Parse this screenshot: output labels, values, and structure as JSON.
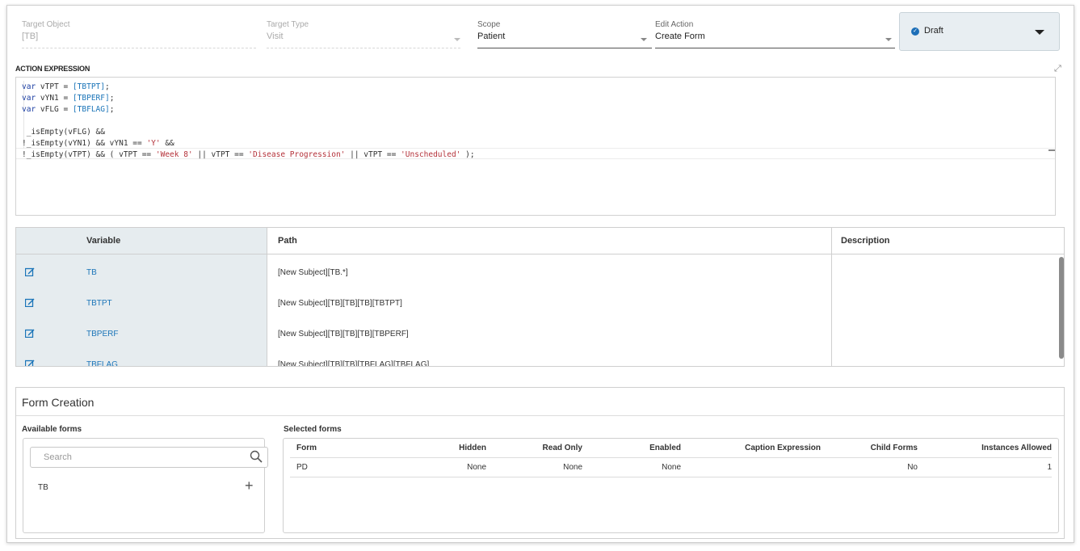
{
  "fields": {
    "target_object": {
      "label": "Target Object",
      "value": "[TB]"
    },
    "target_type": {
      "label": "Target Type",
      "value": "Visit"
    },
    "scope": {
      "label": "Scope",
      "value": "Patient"
    },
    "edit_action": {
      "label": "Edit Action",
      "value": "Create Form"
    }
  },
  "status": {
    "label": "Draft",
    "icon": "check-circle-icon",
    "color": "#1d6fb8"
  },
  "expression": {
    "label": "ACTION EXPRESSION",
    "lines": [
      "var vTPT = [TBTPT];",
      "var vYN1 = [TBPERF];",
      "var vFLG = [TBFLAG];",
      "",
      " _isEmpty(vFLG) &&",
      "!_isEmpty(vYN1) && vYN1 == 'Y' &&",
      "!_isEmpty(vTPT) && ( vTPT == 'Week 8' || vTPT == 'Disease Progression' || vTPT == 'Unscheduled' );"
    ]
  },
  "variables": {
    "headers": {
      "variable": "Variable",
      "path": "Path",
      "description": "Description"
    },
    "rows": [
      {
        "name": "TB",
        "path": "[New Subject][TB.*]",
        "description": ""
      },
      {
        "name": "TBTPT",
        "path": "[New Subject][TB][TB][TB][TBTPT]",
        "description": ""
      },
      {
        "name": "TBPERF",
        "path": "[New Subject][TB][TB][TB][TBPERF]",
        "description": ""
      },
      {
        "name": "TBFLAG",
        "path": "[New Subject][TB][TB][TBFLAG][TBFLAG]",
        "description": ""
      }
    ]
  },
  "form_creation": {
    "title": "Form Creation",
    "available_label": "Available forms",
    "selected_label": "Selected forms",
    "search_placeholder": "Search",
    "available_items": [
      "TB"
    ],
    "selected_headers": [
      "Form",
      "Hidden",
      "Read Only",
      "Enabled",
      "Caption Expression",
      "Child Forms",
      "Instances Allowed"
    ],
    "selected_rows": [
      {
        "form": "PD",
        "hidden": "None",
        "read_only": "None",
        "enabled": "None",
        "caption_expression": "",
        "child_forms": "No",
        "instances_allowed": "1"
      }
    ]
  }
}
